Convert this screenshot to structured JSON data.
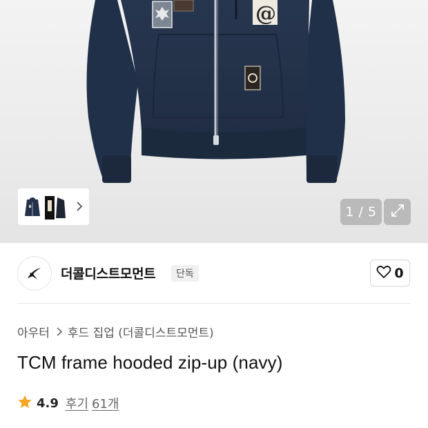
{
  "gallery": {
    "counter": "1 / 5",
    "current_index": 1,
    "total": 5,
    "expand_icon": "expand-arrows-icon",
    "next_icon": "chevron-right-icon"
  },
  "brand": {
    "name": "더콜디스트모먼트",
    "badge": "단독",
    "logo_icon": "star-swoosh-logo"
  },
  "like": {
    "icon": "heart-outline-icon",
    "count": "0"
  },
  "breadcrumb": {
    "category": "아우터",
    "subcategory": "후드 집업 (더콜디스트모먼트)"
  },
  "product": {
    "title": "TCM frame hooded zip-up (navy)"
  },
  "rating": {
    "value": "4.9",
    "review_label": "후기",
    "review_count": "61개",
    "star_color": "#f5a623"
  },
  "colors": {
    "jacket": "#23324a",
    "accent": "#f5a623"
  }
}
